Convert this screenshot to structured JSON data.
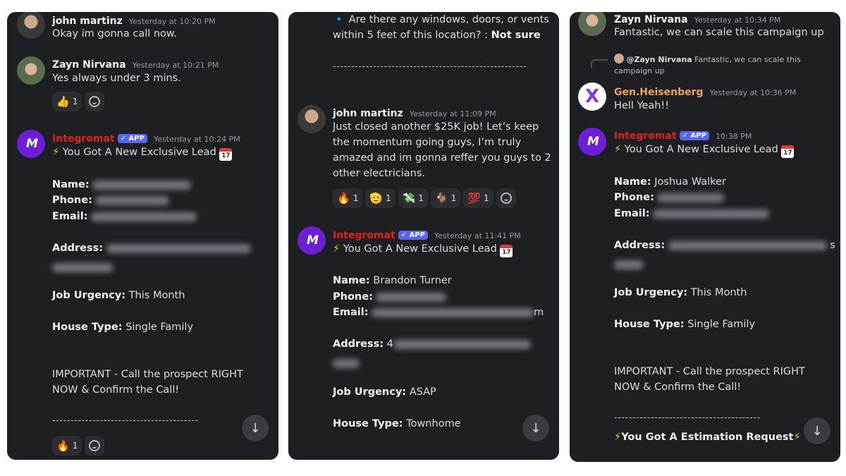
{
  "panel1": {
    "msg1": {
      "author": "john martinz",
      "time": "Yesterday at 10:20 PM",
      "text": "Okay im gonna call now."
    },
    "msg2": {
      "author": "Zayn Nirvana",
      "time": "Yesterday at 10:21 PM",
      "text": "Yes always under 3 mins.",
      "reactions": [
        {
          "emoji": "👍",
          "count": "1"
        }
      ]
    },
    "msg3": {
      "author": "Integromat",
      "badge": "✓ APP",
      "time": "Yesterday at 10:24 PM",
      "headline": "You Got A New Exclusive Lead",
      "name_label": "Name:",
      "phone_label": "Phone:",
      "email_label": "Email:",
      "address_label": "Address:",
      "urgency_label": "Job Urgency:",
      "urgency": "This Month",
      "house_label": "House Type:",
      "house": "Single Family",
      "important": "IMPORTANT - Call the prospect RIGHT NOW & Confirm the Call!",
      "divider": "----------------------------------------",
      "reactions": [
        {
          "emoji": "🔥",
          "count": "1"
        }
      ]
    }
  },
  "panel2": {
    "top_line": "Are there any windows, doors, or vents within 5 feet of this location? :",
    "top_answer": "Not sure",
    "divider": "-----------------------------------------------------",
    "msg1": {
      "author": "john martinz",
      "time": "Yesterday at 11:09 PM",
      "text": "Just closed another $25K job! Let’s keep the momentum going guys, I’m truly amazed and im gonna reffer you guys to 2 other electricians.",
      "reactions": [
        {
          "emoji": "🔥",
          "count": "1"
        },
        {
          "emoji": "🫡",
          "count": "1"
        },
        {
          "emoji": "💸",
          "count": "1"
        },
        {
          "emoji": "🐐",
          "count": "1"
        },
        {
          "emoji": "💯",
          "count": "1"
        }
      ]
    },
    "msg2": {
      "author": "Integromat",
      "badge": "✓ APP",
      "time": "Yesterday at 11:41 PM",
      "headline": "You Got A New Exclusive Lead",
      "name_label": "Name:",
      "name": "Brandon Turner",
      "phone_label": "Phone:",
      "email_label": "Email:",
      "email_tail": "m",
      "address_label": "Address:",
      "address_head": "4",
      "urgency_label": "Job Urgency:",
      "urgency": "ASAP",
      "house_label": "House Type:",
      "house": "Townhome"
    }
  },
  "panel3": {
    "msg1": {
      "author": "Zayn Nirvana",
      "time": "Yesterday at 10:34 PM",
      "text": "Fantastic, we can scale this campaign up"
    },
    "reply": {
      "mention": "@Zayn Nirvana",
      "text": "Fantastic, we can scale this campaign up"
    },
    "msg2": {
      "author": "Gen.Heisenberg",
      "time": "Yesterday at 10:36 PM",
      "text": "Hell Yeah!!"
    },
    "msg3": {
      "author": "Integromat",
      "badge": "✓ APP",
      "time": "10:38 PM",
      "headline": "You Got A New Exclusive Lead",
      "name_label": "Name:",
      "name": "Joshua Walker",
      "phone_label": "Phone:",
      "email_label": "Email:",
      "address_label": "Address:",
      "address_tail": "s",
      "urgency_label": "Job Urgency:",
      "urgency": "This Month",
      "house_label": "House Type:",
      "house": "Single Family",
      "important": "IMPORTANT - Call the prospect RIGHT NOW & Confirm the Call!",
      "divider": "----------------------------------------",
      "estimation": "You Got A Estimation Request"
    }
  },
  "icons": {
    "bolt": "⚡",
    "diamond": "🔹",
    "calendar_day": "17",
    "scroll": "↓",
    "x_logo": "X",
    "make_logo": "M"
  },
  "colors": {
    "bg": "#1e1f22",
    "bot_red": "#e0241b",
    "app_badge": "#5865f2",
    "heisenberg": "#f0a35a"
  }
}
